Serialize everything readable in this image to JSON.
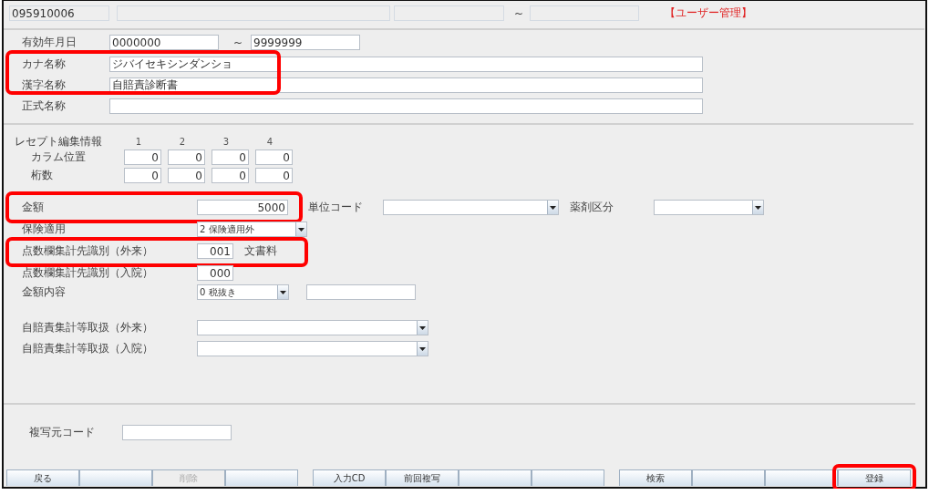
{
  "header": {
    "code": "095910006",
    "tilde": "~",
    "user": "【ユーザー管理】"
  },
  "validity": {
    "label": "有効年月日",
    "from": "0000000",
    "tilde": "~",
    "to": "9999999"
  },
  "names": {
    "highlighted": true,
    "rows": [
      {
        "label": "カナ名称",
        "value": "ジバイセキシンダンショ"
      },
      {
        "label": "漢字名称",
        "value": "自賠責診断書"
      }
    ]
  },
  "formal_name": {
    "label": "正式名称"
  },
  "receipt": {
    "label": "レセプト編集情報",
    "columns": [
      "1",
      "2",
      "3",
      "4"
    ],
    "rows": [
      {
        "label": "カラム位置",
        "values": [
          "0",
          "0",
          "0",
          "0"
        ]
      },
      {
        "label": "桁数",
        "values": [
          "0",
          "0",
          "0",
          "0"
        ]
      }
    ]
  },
  "amount": {
    "label": "金額",
    "value": "5000",
    "highlighted": true,
    "unit_label": "単位コード",
    "drug_label": "薬剤区分"
  },
  "insurance": {
    "label": "保険適用",
    "value": "2 保険適用外"
  },
  "points_out": {
    "label": "点数欄集計先識別（外来）",
    "value": "001",
    "note": "文書料",
    "highlighted": true
  },
  "points_in": {
    "label": "点数欄集計先識別（入院）",
    "value": "000"
  },
  "amount_content": {
    "label": "金額内容",
    "value": "0 税抜き"
  },
  "jibai": [
    {
      "label": "自賠責集計等取扱（外来）"
    },
    {
      "label": "自賠責集計等取扱（入院）"
    }
  ],
  "copy_source": {
    "label": "複写元コード"
  },
  "buttons": [
    [
      {
        "label": "戻る",
        "disabled": false,
        "highlighted": false
      },
      {
        "disabled": false,
        "highlighted": false
      },
      {
        "label": "削除",
        "disabled": true,
        "highlighted": false
      },
      {
        "disabled": false,
        "highlighted": false
      }
    ],
    [
      {
        "label": "入力CD",
        "disabled": false,
        "highlighted": false
      },
      {
        "label": "前回複写",
        "disabled": false,
        "highlighted": false
      },
      {
        "disabled": false,
        "highlighted": false
      },
      {
        "disabled": false,
        "highlighted": false
      }
    ],
    [
      {
        "label": "検索",
        "disabled": false,
        "highlighted": false
      },
      {
        "disabled": false,
        "highlighted": false
      },
      {
        "disabled": false,
        "highlighted": false
      },
      {
        "label": "登録",
        "disabled": false,
        "highlighted": true
      }
    ]
  ]
}
